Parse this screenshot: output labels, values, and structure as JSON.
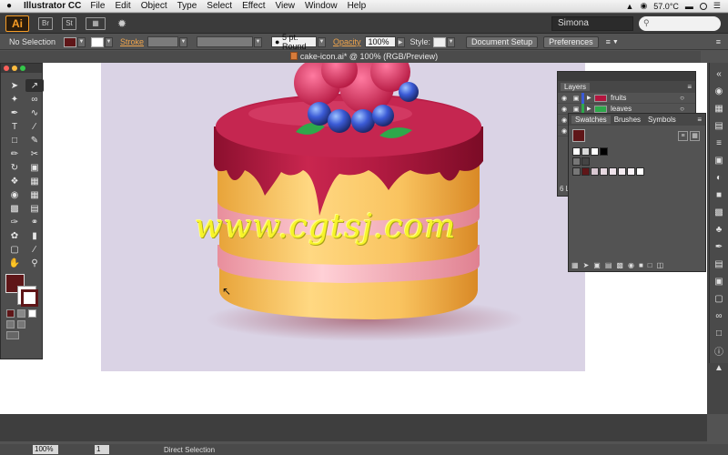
{
  "menubar": {
    "apple": "",
    "app": "Illustrator CC",
    "items": [
      "File",
      "Edit",
      "Object",
      "Type",
      "Select",
      "Effect",
      "View",
      "Window",
      "Help"
    ],
    "temperature": "57.0°C"
  },
  "appbar": {
    "logo": "Ai",
    "bridge": "Br",
    "stock": "St",
    "workspace": "Simona"
  },
  "control": {
    "selection": "No Selection",
    "stroke_label": "Stroke",
    "brush": "5 pt. Round",
    "opacity_label": "Opacity",
    "opacity_value": "100%",
    "style_label": "Style:",
    "document_setup": "Document Setup",
    "preferences": "Preferences"
  },
  "document": {
    "title": "cake-icon.ai* @ 100% (RGB/Preview)"
  },
  "watermark": "www.cgtsj.com",
  "layers_panel": {
    "title": "Layers",
    "rows": [
      {
        "name": "fruits",
        "color": "#3b5bd6"
      },
      {
        "name": "leaves",
        "color": "#2ea84b"
      }
    ],
    "footer": "6 L"
  },
  "swatches_panel": {
    "tabs": [
      "Swatches",
      "Brushes",
      "Symbols"
    ]
  },
  "status": {
    "zoom": "100%",
    "page": "1",
    "tool": "Direct Selection"
  },
  "colors": {
    "fill": "#5f1618",
    "accent": "#f79c25",
    "artboard": "#dad3e5"
  }
}
